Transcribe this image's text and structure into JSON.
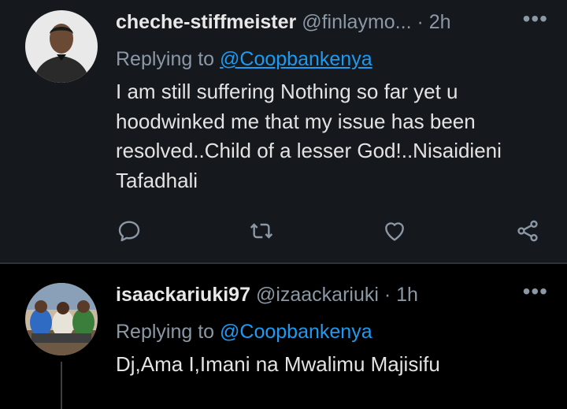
{
  "tweets": [
    {
      "display_name": "cheche-stiffmeister",
      "handle": "@finlaymo...",
      "separator": "·",
      "time": "2h",
      "more_icon": "more-horizontal-icon",
      "replying_prefix": "Replying to",
      "replying_to": "@Coopbankenya",
      "text": "I am still suffering Nothing so far yet u hoodwinked me that my issue has been resolved..Child of a lesser God!..Nisaidieni Tafadhali",
      "actions": [
        "reply-icon",
        "retweet-icon",
        "like-icon",
        "share-icon"
      ]
    },
    {
      "display_name": "isaackariuki97",
      "handle": "@izaackariuki",
      "separator": "·",
      "time": "1h",
      "more_icon": "more-horizontal-icon",
      "replying_prefix": "Replying to",
      "replying_to": "@Coopbankenya",
      "text": "Dj,Ama I,Imani na Mwalimu Majisifu"
    }
  ],
  "colors": {
    "background": "#000000",
    "tweet_highlight_bg": "#15181c",
    "mention": "#1d9bf0",
    "muted": "#8b98a5"
  },
  "more_glyph": "•••"
}
